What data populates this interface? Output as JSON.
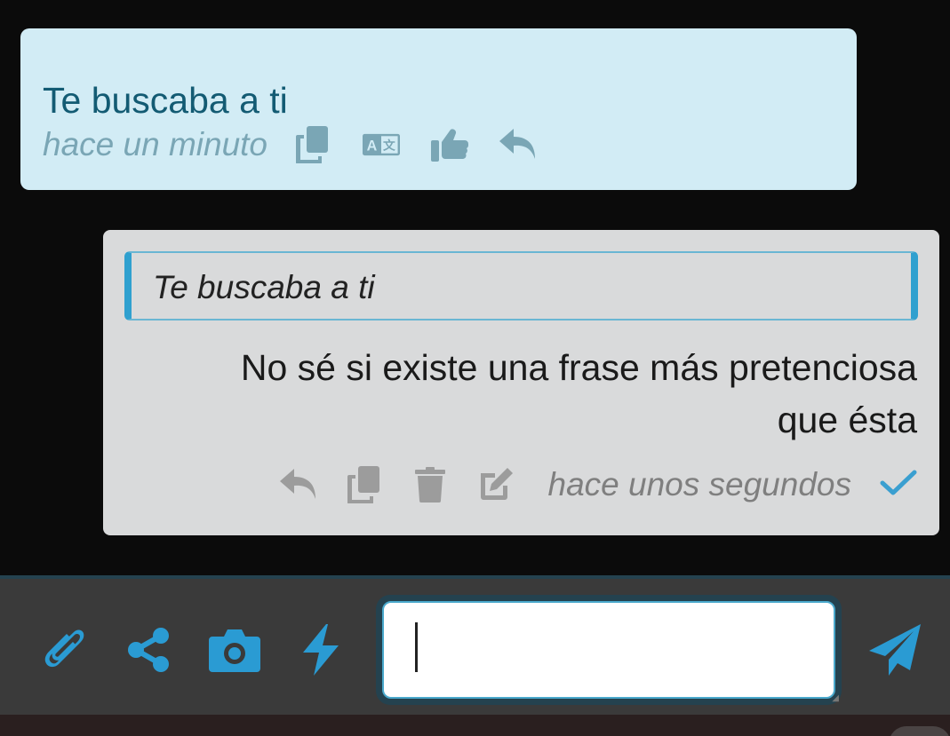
{
  "incoming_message": {
    "text": "Te buscaba a ti",
    "time": "hace un minuto",
    "icons": [
      "copy-icon",
      "translate-icon",
      "thumbs-up-icon",
      "reply-icon"
    ]
  },
  "outgoing_message": {
    "quoted_text": "Te buscaba a ti",
    "body_line1": "No sé si existe una frase más pretenciosa",
    "body_line2": "que ésta",
    "time": "hace unos segundos",
    "icons": [
      "reply-icon",
      "copy-icon",
      "trash-icon",
      "edit-icon",
      "check-icon"
    ]
  },
  "composer": {
    "input_value": "",
    "tools": [
      "paperclip-icon",
      "share-icon",
      "camera-icon",
      "bolt-icon",
      "send-icon"
    ]
  },
  "colors": {
    "accent": "#2a9bd3",
    "incoming_bg": "#d2ecf5",
    "outgoing_bg": "#d9dadb",
    "composer_bg": "#3a3a3a",
    "background": "#0b0b0b"
  }
}
